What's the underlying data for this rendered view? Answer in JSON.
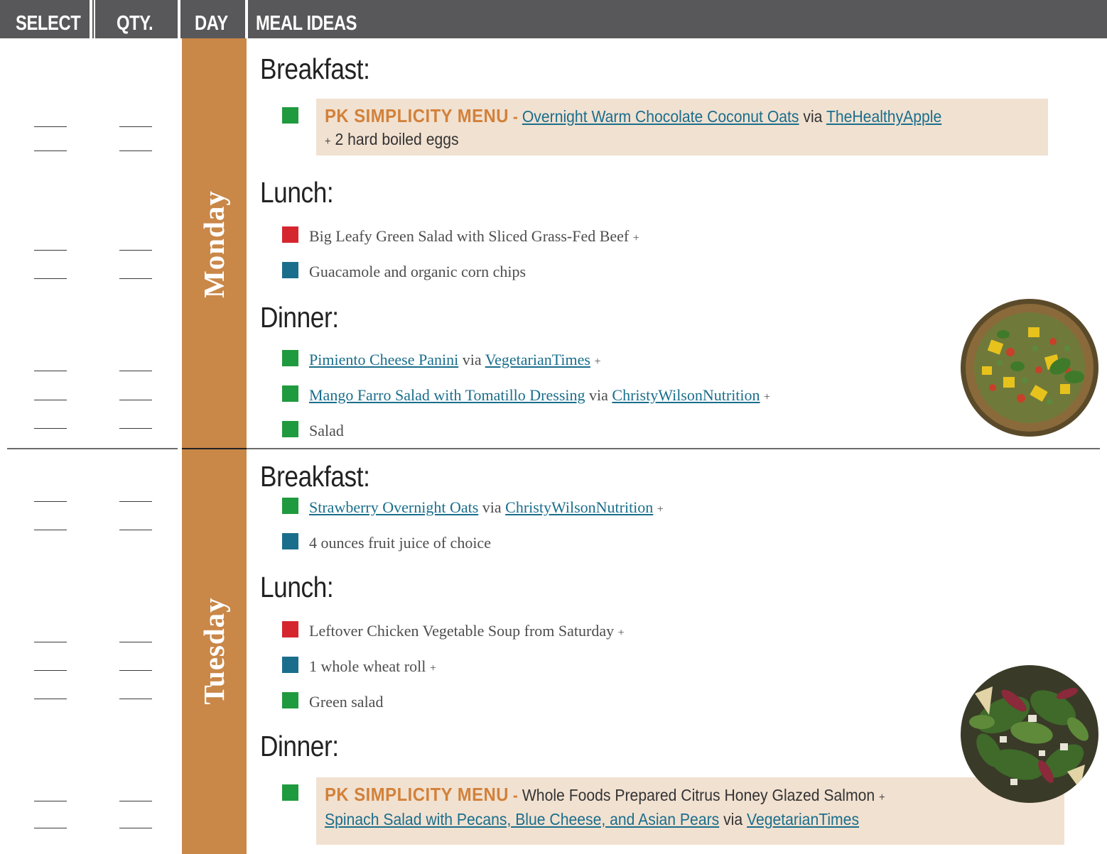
{
  "header": {
    "select": "SELECT",
    "qty": "QTY.",
    "day": "DAY",
    "meal_ideas": "MEAL IDEAS"
  },
  "colors": {
    "header_bg": "#58585a",
    "day_bar": "#c98748",
    "pk_box": "#f1e1d1",
    "pk_title": "#d2813a",
    "square_green": "#1f9a3e",
    "square_red": "#d5262f",
    "square_blue": "#1a6e8c",
    "link": "#1a6e8c"
  },
  "monday": {
    "day": "Monday",
    "breakfast_title": "Breakfast:",
    "breakfast": {
      "pk_label": "PK SIMPLICITY MENU",
      "dash": "-",
      "link1": "Overnight Warm Chocolate Coconut Oats",
      "via": "via",
      "link2": "TheHealthyApple",
      "plus": "+",
      "line2": "2 hard boiled eggs"
    },
    "lunch_title": "Lunch:",
    "lunch": [
      {
        "text": "Big Leafy Green Salad with Sliced Grass-Fed Beef",
        "plus": "+"
      },
      {
        "text": "Guacamole and organic corn chips"
      }
    ],
    "dinner_title": "Dinner:",
    "dinner": [
      {
        "link1": "Pimiento Cheese Panini",
        "via": "via",
        "link2": "VegetarianTimes",
        "plus": "+"
      },
      {
        "link1": "Mango Farro Salad with Tomatillo Dressing",
        "via": "via",
        "link2": "ChristyWilsonNutrition",
        "plus": "+"
      },
      {
        "text": "Salad"
      }
    ]
  },
  "tuesday": {
    "day": "Tuesday",
    "breakfast_title": "Breakfast:",
    "breakfast": [
      {
        "link1": "Strawberry Overnight Oats",
        "via": "via",
        "link2": "ChristyWilsonNutrition",
        "plus": "+"
      },
      {
        "text": "4 ounces fruit juice of choice"
      }
    ],
    "lunch_title": "Lunch:",
    "lunch": [
      {
        "text": "Leftover Chicken Vegetable Soup from Saturday",
        "plus": "+"
      },
      {
        "text": "1 whole wheat roll",
        "plus": "+"
      },
      {
        "text": "Green salad"
      }
    ],
    "dinner_title": "Dinner:",
    "dinner": {
      "pk_label": "PK SIMPLICITY MENU",
      "dash": "-",
      "text1": "Whole Foods Prepared Citrus Honey Glazed Salmon",
      "plus": "+",
      "link1": "Spinach Salad with Pecans, Blue Cheese, and Asian Pears",
      "via": "via",
      "link2": "VegetarianTimes"
    }
  }
}
